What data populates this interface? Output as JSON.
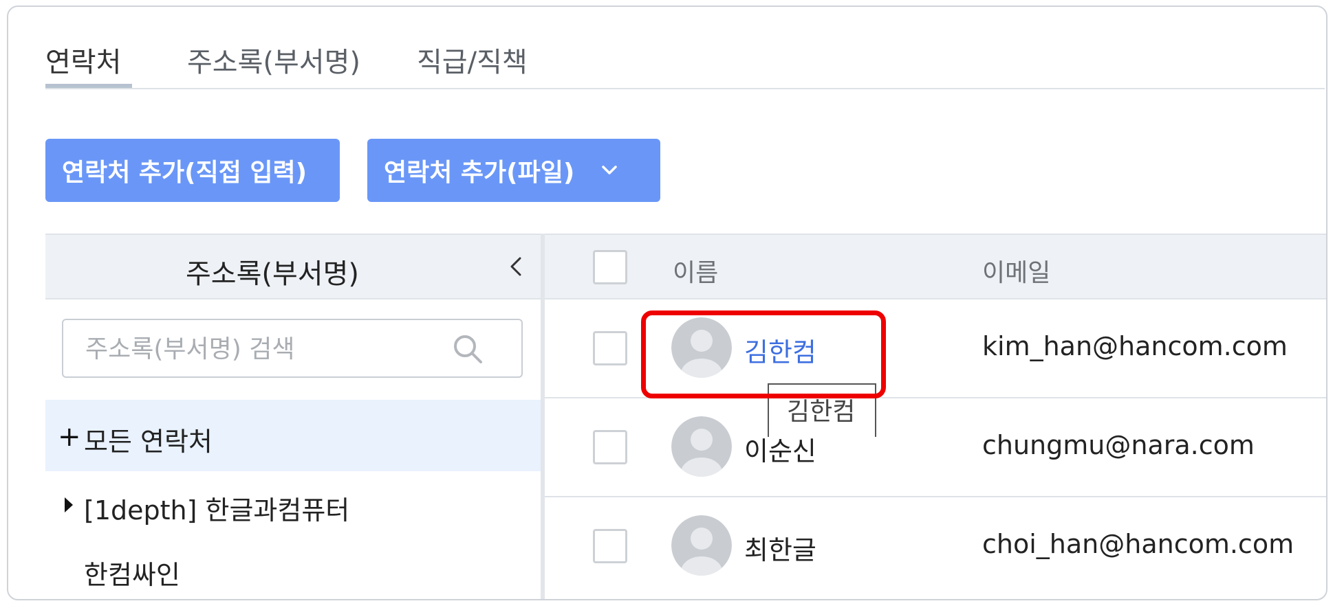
{
  "tabs": [
    {
      "label": "연락처",
      "active": true
    },
    {
      "label": "주소록(부서명)",
      "active": false
    },
    {
      "label": "직급/직책",
      "active": false
    }
  ],
  "toolbar": {
    "add_direct_label": "연락처 추가(직접 입력)",
    "add_file_label": "연락처 추가(파일)"
  },
  "sidebar": {
    "title": "주소록(부서명)",
    "search_placeholder": "주소록(부서명) 검색",
    "items": [
      {
        "label": "모든 연락처",
        "icon": "plus-icon",
        "selected": true
      },
      {
        "label": "[1depth] 한글과컴퓨터",
        "icon": "caret-right-icon",
        "selected": false
      },
      {
        "label": "한컴싸인",
        "selected": false
      }
    ]
  },
  "table": {
    "columns": {
      "name": "이름",
      "email": "이메일"
    },
    "rows": [
      {
        "name": "김한컴",
        "email": "kim_han@hancom.com",
        "highlighted": true
      },
      {
        "name": "이순신",
        "email": "chungmu@nara.com",
        "highlighted": false
      },
      {
        "name": "최한글",
        "email": "choi_han@hancom.com",
        "highlighted": false
      }
    ]
  },
  "tooltip": {
    "text": "김한컴"
  },
  "colors": {
    "primary_button": "#6a97f7",
    "link": "#3e6fe0",
    "highlight": "#ee0000",
    "selected_row": "#e9f2fd"
  }
}
